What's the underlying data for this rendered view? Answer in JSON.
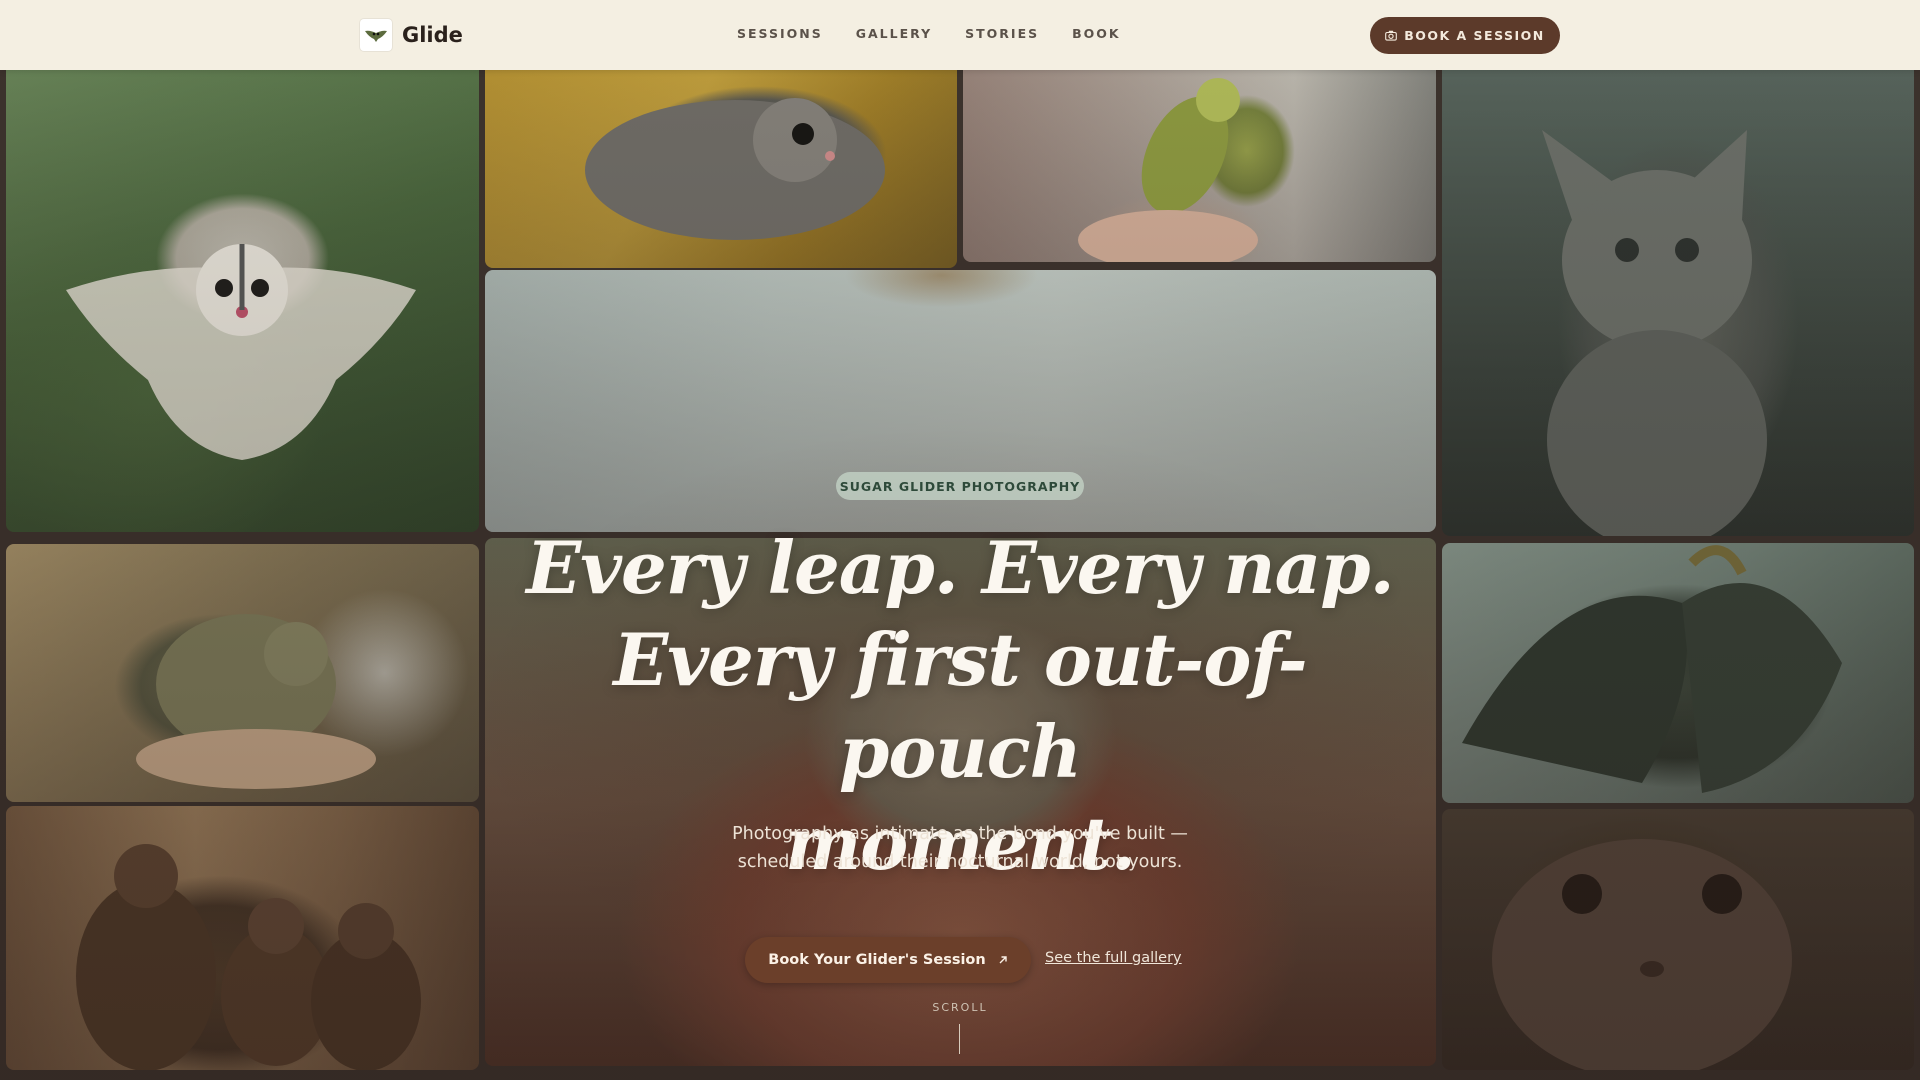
{
  "brand": {
    "name": "Glide",
    "logo_icon": "glider-logo-icon"
  },
  "nav": {
    "links": [
      "SESSIONS",
      "GALLERY",
      "STORIES",
      "BOOK"
    ],
    "cta_label": "BOOK A SESSION",
    "cta_icon": "camera-icon"
  },
  "hero": {
    "tag": "SUGAR GLIDER PHOTOGRAPHY",
    "headline_line1": "Every leap. Every nap.",
    "headline_line2": "Every first out-of-pouch",
    "headline_line3": "moment.",
    "subtext": "Photography as intimate as the bond you've built — scheduled around their nocturnal world, not yours.",
    "primary_cta": "Book Your Glider's Session",
    "primary_cta_icon": "arrow-up-right-icon",
    "secondary_link": "See the full gallery",
    "scroll_label": "SCROLL"
  },
  "colors": {
    "nav_bg": "#f4efe2",
    "cta_brown": "#5c3a2a",
    "tag_green": "#2e4a3a"
  }
}
